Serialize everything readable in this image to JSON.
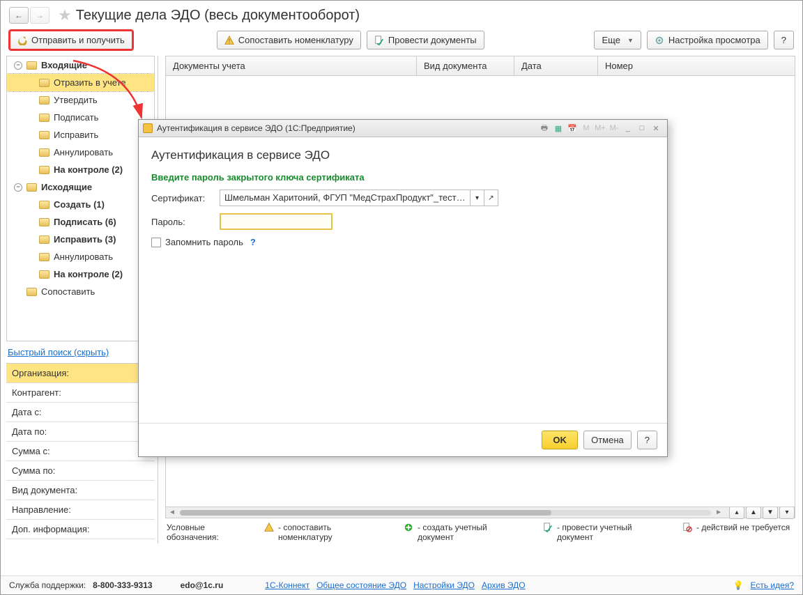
{
  "header": {
    "title": "Текущие дела ЭДО (весь документооборот)"
  },
  "toolbar": {
    "send_receive": "Отправить и получить",
    "match_nomenclature": "Сопоставить номенклатуру",
    "post_documents": "Провести документы",
    "more": "Еще",
    "view_settings": "Настройка просмотра",
    "help": "?"
  },
  "tree": {
    "incoming": "Входящие",
    "incoming_items": [
      "Отразить в учете",
      "Утвердить",
      "Подписать",
      "Исправить",
      "Аннулировать",
      "На контроле (2)"
    ],
    "outgoing": "Исходящие",
    "outgoing_items": [
      "Создать (1)",
      "Подписать (6)",
      "Исправить (3)",
      "Аннулировать",
      "На контроле (2)"
    ],
    "match": "Сопоставить"
  },
  "quick_search": "Быстрый поиск (скрыть)",
  "filters": [
    "Организация:",
    "Контрагент:",
    "Дата с:",
    "Дата по:",
    "Сумма с:",
    "Сумма по:",
    "Вид документа:",
    "Направление:",
    "Доп. информация:"
  ],
  "grid": {
    "columns": [
      "Документы учета",
      "Вид документа",
      "Дата",
      "Номер"
    ]
  },
  "legend": {
    "label": "Условные обозначения:",
    "items": [
      "- сопоставить номенклатуру",
      "- создать учетный документ",
      "- провести учетный документ",
      "- действий не требуется"
    ]
  },
  "footer": {
    "support_label": "Служба поддержки:",
    "phone": "8-800-333-9313",
    "email": "edo@1c.ru",
    "links": [
      "1С-Коннект",
      "Общее состояние ЭДО",
      "Настройки ЭДО",
      "Архив ЭДО"
    ],
    "idea": "Есть идея?"
  },
  "modal": {
    "titlebar": "Аутентификация в сервисе ЭДО  (1С:Предприятие)",
    "heading": "Аутентификация в сервисе ЭДО",
    "subheading": "Введите пароль закрытого ключа сертификата",
    "cert_label": "Сертификат:",
    "cert_value": "Шмельман Харитоний, ФГУП \"МедСтрахПродукт\"_тест_, Рук",
    "password_label": "Пароль:",
    "remember": "Запомнить пароль",
    "ok": "OK",
    "cancel": "Отмена",
    "help": "?",
    "tb_icons": [
      "M",
      "M+",
      "M-"
    ]
  }
}
